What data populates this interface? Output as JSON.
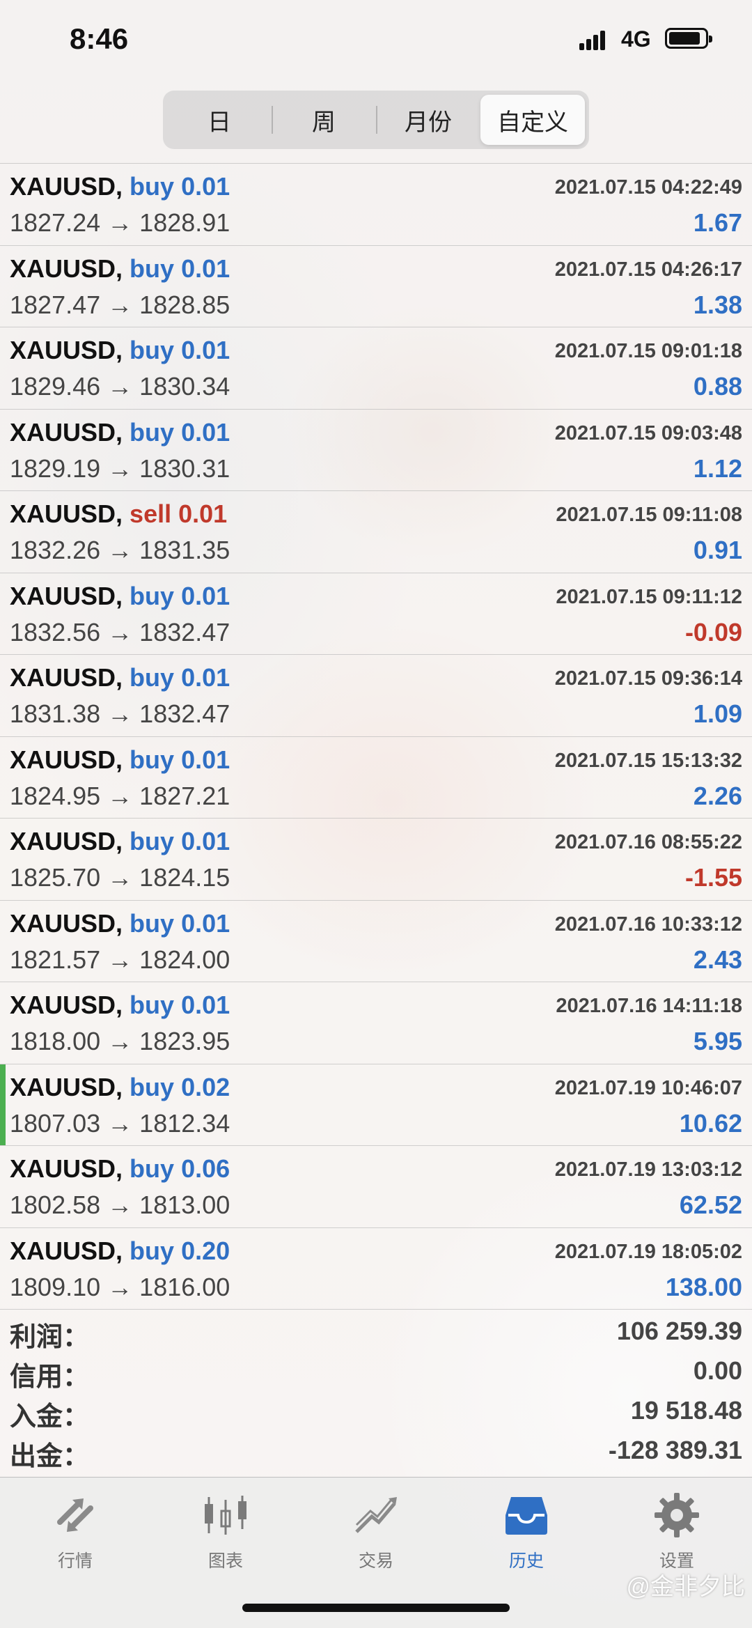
{
  "status_bar": {
    "time": "8:46",
    "network": "4G"
  },
  "period_tabs": [
    {
      "label": "日"
    },
    {
      "label": "周"
    },
    {
      "label": "月份"
    },
    {
      "label": "自定义"
    }
  ],
  "active_period": "自定义",
  "trades": [
    {
      "symbol": "XAUUSD,",
      "side": "buy",
      "volume": "0.01",
      "date": "2021.07.15 04:22:49",
      "open": "1827.24",
      "arrow": "→",
      "close": "1828.91",
      "profit": "1.67"
    },
    {
      "symbol": "XAUUSD,",
      "side": "buy",
      "volume": "0.01",
      "date": "2021.07.15 04:26:17",
      "open": "1827.47",
      "arrow": "→",
      "close": "1828.85",
      "profit": "1.38"
    },
    {
      "symbol": "XAUUSD,",
      "side": "buy",
      "volume": "0.01",
      "date": "2021.07.15 09:01:18",
      "open": "1829.46",
      "arrow": "→",
      "close": "1830.34",
      "profit": "0.88"
    },
    {
      "symbol": "XAUUSD,",
      "side": "buy",
      "volume": "0.01",
      "date": "2021.07.15 09:03:48",
      "open": "1829.19",
      "arrow": "→",
      "close": "1830.31",
      "profit": "1.12"
    },
    {
      "symbol": "XAUUSD,",
      "side": "sell",
      "volume": "0.01",
      "date": "2021.07.15 09:11:08",
      "open": "1832.26",
      "arrow": "→",
      "close": "1831.35",
      "profit": "0.91"
    },
    {
      "symbol": "XAUUSD,",
      "side": "buy",
      "volume": "0.01",
      "date": "2021.07.15 09:11:12",
      "open": "1832.56",
      "arrow": "→",
      "close": "1832.47",
      "profit": "-0.09"
    },
    {
      "symbol": "XAUUSD,",
      "side": "buy",
      "volume": "0.01",
      "date": "2021.07.15 09:36:14",
      "open": "1831.38",
      "arrow": "→",
      "close": "1832.47",
      "profit": "1.09"
    },
    {
      "symbol": "XAUUSD,",
      "side": "buy",
      "volume": "0.01",
      "date": "2021.07.15 15:13:32",
      "open": "1824.95",
      "arrow": "→",
      "close": "1827.21",
      "profit": "2.26"
    },
    {
      "symbol": "XAUUSD,",
      "side": "buy",
      "volume": "0.01",
      "date": "2021.07.16 08:55:22",
      "open": "1825.70",
      "arrow": "→",
      "close": "1824.15",
      "profit": "-1.55"
    },
    {
      "symbol": "XAUUSD,",
      "side": "buy",
      "volume": "0.01",
      "date": "2021.07.16 10:33:12",
      "open": "1821.57",
      "arrow": "→",
      "close": "1824.00",
      "profit": "2.43"
    },
    {
      "symbol": "XAUUSD,",
      "side": "buy",
      "volume": "0.01",
      "date": "2021.07.16 14:11:18",
      "open": "1818.00",
      "arrow": "→",
      "close": "1823.95",
      "profit": "5.95"
    },
    {
      "symbol": "XAUUSD,",
      "side": "buy",
      "volume": "0.02",
      "date": "2021.07.19 10:46:07",
      "open": "1807.03",
      "arrow": "→",
      "close": "1812.34",
      "profit": "10.62",
      "highlighted": true
    },
    {
      "symbol": "XAUUSD,",
      "side": "buy",
      "volume": "0.06",
      "date": "2021.07.19 13:03:12",
      "open": "1802.58",
      "arrow": "→",
      "close": "1813.00",
      "profit": "62.52"
    },
    {
      "symbol": "XAUUSD,",
      "side": "buy",
      "volume": "0.20",
      "date": "2021.07.19 18:05:02",
      "open": "1809.10",
      "arrow": "→",
      "close": "1816.00",
      "profit": "138.00"
    }
  ],
  "summary": [
    {
      "label": "利润：",
      "value": "106 259.39"
    },
    {
      "label": "信用：",
      "value": "0.00"
    },
    {
      "label": "入金：",
      "value": "19 518.48"
    },
    {
      "label": "出金：",
      "value": "-128 389.31"
    }
  ],
  "tab_bar": [
    {
      "label": "行情",
      "icon": "quotes-arrows-icon"
    },
    {
      "label": "图表",
      "icon": "candlestick-chart-icon"
    },
    {
      "label": "交易",
      "icon": "trade-chart-icon"
    },
    {
      "label": "历史",
      "icon": "history-inbox-icon"
    },
    {
      "label": "设置",
      "icon": "gear-icon"
    }
  ],
  "active_tab": "历史",
  "watermark": "@金非夕比",
  "colors": {
    "accent": "#2f6fc4",
    "negative": "#c0392b",
    "highlight_bar": "#4caf50"
  }
}
